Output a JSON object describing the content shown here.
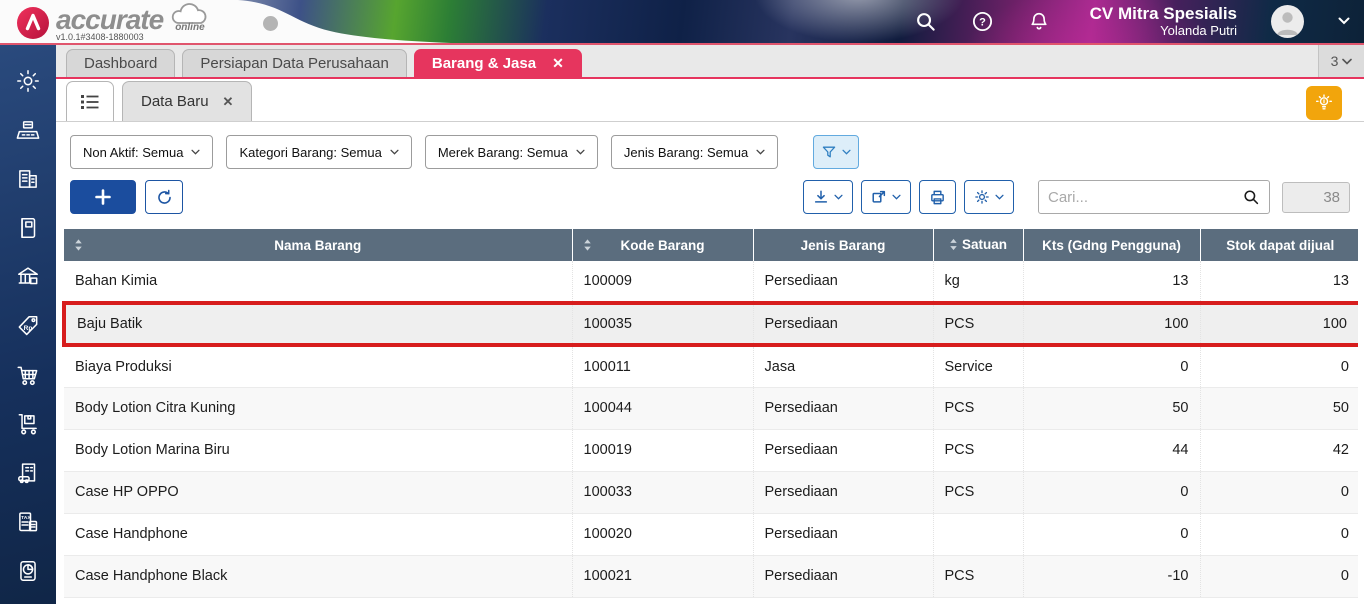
{
  "header": {
    "logo_word": "accurate",
    "logo_sub": "online",
    "version": "v1.0.1#3408-1880003",
    "company": "CV Mitra Spesialis",
    "user": "Yolanda Putri"
  },
  "icons": {
    "close": "✕",
    "sidebar": [
      "settings-icon",
      "cash-register-icon",
      "company-icon",
      "journal-icon",
      "bank-icon",
      "price-tag-icon",
      "purchase-cart-icon",
      "inventory-icon",
      "fixed-asset-icon",
      "tax-icon",
      "report-icon"
    ],
    "toolbar": [
      "download-icon",
      "export-icon",
      "print-icon",
      "settings-icon"
    ]
  },
  "colors": {
    "active_tab": "#e6355e",
    "primary_blue": "#1b4d9e",
    "table_header": "#5b6d7e",
    "highlight_red": "#d71d1d",
    "bulb_yellow": "#f2a50c"
  },
  "tabs": [
    {
      "label": "Dashboard",
      "active": false
    },
    {
      "label": "Persiapan Data Perusahaan",
      "active": false
    },
    {
      "label": "Barang & Jasa",
      "active": true,
      "closable": true
    }
  ],
  "tab_overflow_count": "3",
  "inner_tab": {
    "label": "Data Baru",
    "closable": true
  },
  "filters": [
    {
      "label": "Non Aktif: Semua"
    },
    {
      "label": "Kategori Barang: Semua"
    },
    {
      "label": "Merek Barang: Semua"
    },
    {
      "label": "Jenis Barang: Semua"
    }
  ],
  "search": {
    "placeholder": "Cari...",
    "result_count": "38"
  },
  "table": {
    "columns": [
      {
        "label": "Nama Barang",
        "sortable": true
      },
      {
        "label": "Kode Barang",
        "sortable": true
      },
      {
        "label": "Jenis Barang",
        "sortable": false
      },
      {
        "label": "Satuan",
        "sortable": true
      },
      {
        "label": "Kts (Gdng Pengguna)",
        "sortable": false
      },
      {
        "label": "Stok dapat dijual",
        "sortable": false
      }
    ],
    "rows": [
      {
        "name": "Bahan Kimia",
        "code": "100009",
        "type": "Persediaan",
        "unit": "kg",
        "qty": "13",
        "stock": "13",
        "highlighted": false
      },
      {
        "name": "Baju Batik",
        "code": "100035",
        "type": "Persediaan",
        "unit": "PCS",
        "qty": "100",
        "stock": "100",
        "highlighted": true
      },
      {
        "name": "Biaya Produksi",
        "code": "100011",
        "type": "Jasa",
        "unit": "Service",
        "qty": "0",
        "stock": "0",
        "highlighted": false
      },
      {
        "name": "Body Lotion Citra Kuning",
        "code": "100044",
        "type": "Persediaan",
        "unit": "PCS",
        "qty": "50",
        "stock": "50",
        "highlighted": false
      },
      {
        "name": "Body Lotion Marina Biru",
        "code": "100019",
        "type": "Persediaan",
        "unit": "PCS",
        "qty": "44",
        "stock": "42",
        "highlighted": false
      },
      {
        "name": "Case HP OPPO",
        "code": "100033",
        "type": "Persediaan",
        "unit": "PCS",
        "qty": "0",
        "stock": "0",
        "highlighted": false
      },
      {
        "name": "Case Handphone",
        "code": "100020",
        "type": "Persediaan",
        "unit": "",
        "qty": "0",
        "stock": "0",
        "highlighted": false
      },
      {
        "name": "Case Handphone Black",
        "code": "100021",
        "type": "Persediaan",
        "unit": "PCS",
        "qty": "-10",
        "stock": "0",
        "highlighted": false
      }
    ]
  }
}
